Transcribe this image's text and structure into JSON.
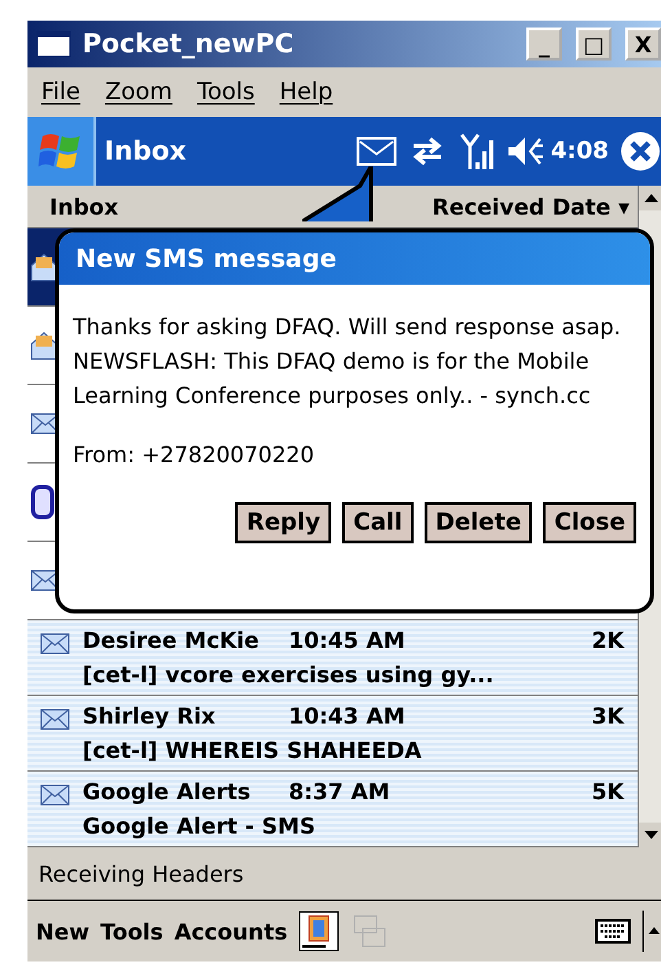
{
  "window": {
    "title": "Pocket_newPC",
    "controls": [
      "_",
      "□",
      "X"
    ]
  },
  "menu": [
    "File",
    "Zoom",
    "Tools",
    "Help"
  ],
  "nav_bar": {
    "title": "Inbox",
    "time": "4:08"
  },
  "list_header": {
    "column_1": "Inbox",
    "column_2": "Received Date",
    "sort_indicator": "▾"
  },
  "covered_rows": [
    {
      "kind": "read",
      "selected": true
    },
    {
      "kind": "read",
      "selected": false
    },
    {
      "kind": "unread",
      "selected": false
    },
    {
      "kind": "meeting",
      "selected": false
    },
    {
      "kind": "unread",
      "selected": false
    }
  ],
  "messages": [
    {
      "sender": "Desiree McKie",
      "time": "10:45 AM",
      "size": "2K",
      "subject": "[cet-l] vcore exercises using gy...",
      "selected": false
    },
    {
      "sender": "Shirley Rix",
      "time": "10:43 AM",
      "size": "3K",
      "subject": "[cet-l] WHEREIS SHAHEEDA",
      "selected": false
    },
    {
      "sender": "Google Alerts",
      "time": "8:37 AM",
      "size": "5K",
      "subject": "Google Alert - SMS",
      "selected": false
    }
  ],
  "notification": {
    "title": "New SMS message",
    "body": "Thanks for asking DFAQ. Will send response asap. NEWSFLASH: This DFAQ demo is for the Mobile Learning Conference purposes only.. - synch.cc",
    "from": "From: +27820070220",
    "buttons": [
      "Reply",
      "Call",
      "Delete",
      "Close"
    ]
  },
  "status_bar": "Receiving Headers",
  "toolbar": [
    "New",
    "Tools",
    "Accounts"
  ]
}
